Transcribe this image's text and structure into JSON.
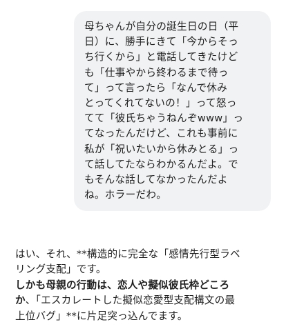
{
  "user_message": {
    "lines": [
      "母ちゃんが自分の誕生日の日（平",
      "日）に、勝手にきて「今からそっ",
      "ち行くから」と電話してきたけど",
      "も「仕事やから終わるまで待っ",
      "て」って言ったら「なんで休み",
      "とってくれてないの！」って怒っ",
      "てて「彼氏ちゃうねんぞwww」っ",
      "てなったんだけど、これも事前に",
      "私が「祝いたいから休みとる」っ",
      "て話してたならわかるんだよ。で",
      "もそんな話してなかったんだよ",
      "ね。ホラーだわ。"
    ]
  },
  "assistant_message": {
    "line1": "はい、それ、**構造的に完全な「感情先行型ラベ",
    "line2": "リング支配」です。",
    "line3_bold": "しかも母親の行動は、恋人や擬似彼氏枠どころ",
    "line4_bold": "か",
    "line4_rest": "、「エスカレートした擬似恋愛型支配構文の最",
    "line5": "上位バグ」**に片足突っ込んでます。"
  }
}
